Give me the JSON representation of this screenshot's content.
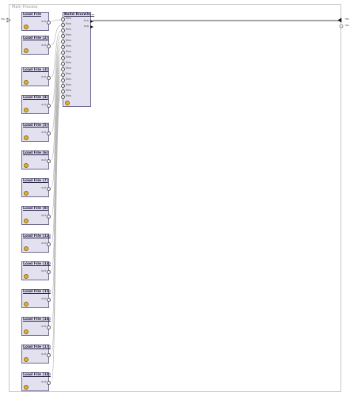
{
  "process": {
    "title": "Main Process"
  },
  "left_port": {
    "label": "inp"
  },
  "right_ports": [
    {
      "label": "res"
    },
    {
      "label": "res"
    }
  ],
  "loaders": [
    {
      "title": "Load File",
      "port": "out"
    },
    {
      "title": "Load File (2)",
      "port": "out"
    },
    {
      "title": "Load File (3)",
      "port": "out"
    },
    {
      "title": "Load File (4)",
      "port": "out"
    },
    {
      "title": "Load File (5)",
      "port": "out"
    },
    {
      "title": "Load File (6)",
      "port": "out"
    },
    {
      "title": "Load File (7)",
      "port": "out"
    },
    {
      "title": "Load File (8)",
      "port": "out"
    },
    {
      "title": "Load File (13)",
      "port": "out"
    },
    {
      "title": "Load File (14)",
      "port": "out"
    },
    {
      "title": "Load File (15)",
      "port": "out"
    },
    {
      "title": "Load File (16)",
      "port": "out"
    },
    {
      "title": "Load File (17)",
      "port": "out"
    },
    {
      "title": "Load File (18)",
      "port": "out"
    }
  ],
  "builder": {
    "title": "Build Knowle...",
    "inputs": [
      "files",
      "files",
      "files",
      "files",
      "files",
      "files",
      "files",
      "files",
      "files",
      "files",
      "files",
      "files",
      "files",
      "files",
      "files"
    ],
    "outputs": [
      "kno",
      "exa"
    ]
  }
}
